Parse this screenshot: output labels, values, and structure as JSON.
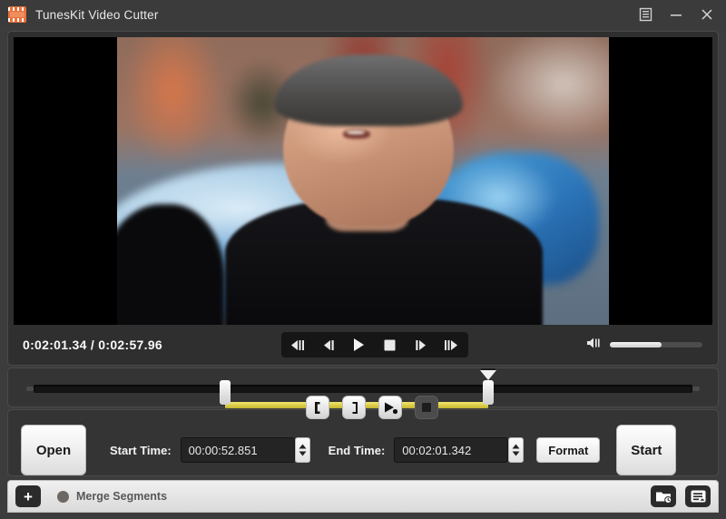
{
  "window": {
    "title": "TunesKit Video Cutter",
    "logo_icon": "film-strip-logo",
    "menu_icon": "menu-list-icon",
    "minimize_icon": "minimize-icon",
    "close_icon": "close-icon"
  },
  "player": {
    "current_time": "0:02:01.34",
    "separator": "/",
    "total_time": "0:02:57.96",
    "timecode": "0:02:01.34 / 0:02:57.96",
    "controls": [
      {
        "name": "step-back-fast-button",
        "icon": "skip-backward-icon"
      },
      {
        "name": "step-back-button",
        "icon": "previous-frame-icon"
      },
      {
        "name": "play-button",
        "icon": "play-icon"
      },
      {
        "name": "stop-button",
        "icon": "stop-icon"
      },
      {
        "name": "step-forward-button",
        "icon": "next-frame-icon"
      },
      {
        "name": "step-forward-fast-button",
        "icon": "skip-forward-icon"
      }
    ],
    "volume": {
      "icon": "volume-icon",
      "level_percent": 56
    }
  },
  "timeline": {
    "selection_start_percent": 29,
    "selection_end_percent": 69,
    "playhead_percent": 69
  },
  "trim_tools": [
    {
      "name": "set-start-point-button",
      "icon": "bracket-open-icon",
      "glyph": "["
    },
    {
      "name": "set-end-point-button",
      "icon": "bracket-close-icon",
      "glyph": "]"
    },
    {
      "name": "preview-segment-button",
      "icon": "play-preview-icon",
      "glyph": "▶"
    },
    {
      "name": "stop-preview-button",
      "icon": "stop-preview-icon",
      "glyph": "■"
    }
  ],
  "controls": {
    "open_label": "Open",
    "start_time_label": "Start Time:",
    "start_time_value": "00:00:52.851",
    "end_time_label": "End Time:",
    "end_time_value": "00:02:01.342",
    "format_label": "Format",
    "start_label": "Start",
    "spinner_up_icon": "chevron-up-icon",
    "spinner_down_icon": "chevron-down-icon"
  },
  "bottom_bar": {
    "add_label": "+",
    "merge_label": "Merge Segments",
    "merge_checked": false,
    "history_icon": "folder-clock-icon",
    "settings_icon": "list-settings-icon"
  },
  "colors": {
    "accent_selection": "#ded04f",
    "logo": "#e8703a",
    "window_bg": "#3c3c3c",
    "panel_bg": "#343434",
    "bottom_bar_bg": "#e6e6e6"
  }
}
